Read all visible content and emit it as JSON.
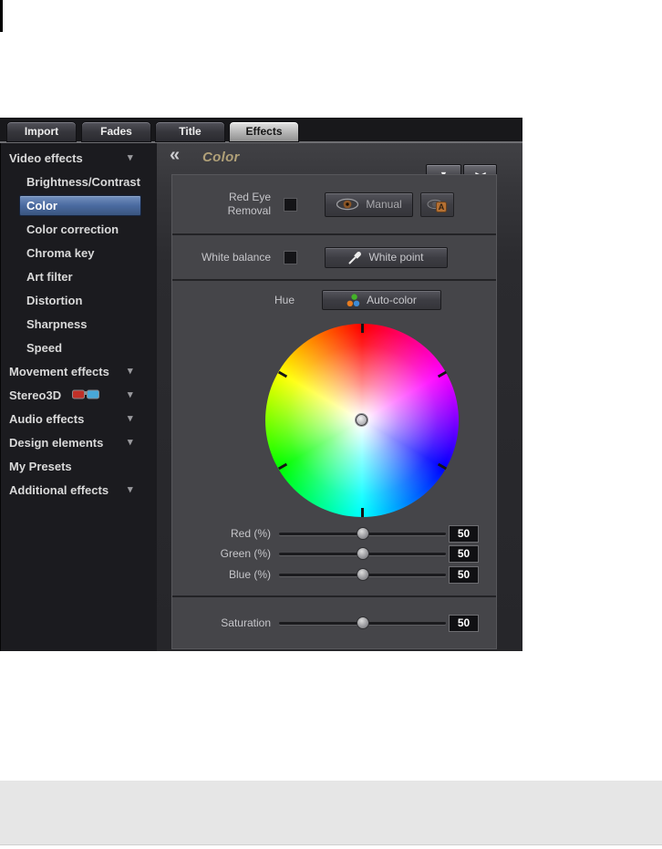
{
  "tabs": [
    {
      "label": "Import",
      "selected": false
    },
    {
      "label": "Fades",
      "selected": false
    },
    {
      "label": "Title",
      "selected": false
    },
    {
      "label": "Effects",
      "selected": true
    }
  ],
  "sidebar": {
    "items": [
      {
        "label": "Video effects",
        "level": "header",
        "has_arrow": true,
        "selected": false
      },
      {
        "label": "Brightness/Contrast",
        "level": "child",
        "has_arrow": false,
        "selected": false
      },
      {
        "label": "Color",
        "level": "child",
        "has_arrow": false,
        "selected": true
      },
      {
        "label": "Color correction",
        "level": "child",
        "has_arrow": false,
        "selected": false
      },
      {
        "label": "Chroma key",
        "level": "child",
        "has_arrow": false,
        "selected": false
      },
      {
        "label": "Art filter",
        "level": "child",
        "has_arrow": false,
        "selected": false
      },
      {
        "label": "Distortion",
        "level": "child",
        "has_arrow": false,
        "selected": false
      },
      {
        "label": "Sharpness",
        "level": "child",
        "has_arrow": false,
        "selected": false
      },
      {
        "label": "Speed",
        "level": "child",
        "has_arrow": false,
        "selected": false
      },
      {
        "label": "Movement effects",
        "level": "header",
        "has_arrow": true,
        "selected": false
      },
      {
        "label": "Stereo3D",
        "level": "header",
        "has_arrow": true,
        "icon": "3d-glasses",
        "selected": false
      },
      {
        "label": "Audio effects",
        "level": "header",
        "has_arrow": true,
        "selected": false
      },
      {
        "label": "Design elements",
        "level": "header",
        "has_arrow": true,
        "selected": false
      },
      {
        "label": "My Presets",
        "level": "header",
        "has_arrow": false,
        "selected": false
      },
      {
        "label": "Additional effects",
        "level": "header",
        "has_arrow": true,
        "selected": false
      }
    ]
  },
  "panel": {
    "title": "Color",
    "red_eye": {
      "label_line1": "Red Eye",
      "label_line2": "Removal",
      "checkbox_checked": false,
      "manual_button": "Manual"
    },
    "white_balance": {
      "label": "White balance",
      "checkbox_checked": false,
      "button": "White point"
    },
    "hue": {
      "label": "Hue",
      "auto_color_button": "Auto-color"
    },
    "color_wheel": {
      "type": "hue-wheel",
      "hues_clockwise_from_top": [
        "red",
        "magenta",
        "blue",
        "cyan",
        "green",
        "yellow"
      ],
      "tick_count": 6,
      "selection_position": "center"
    },
    "rgb_sliders": [
      {
        "label": "Red (%)",
        "value": "50",
        "percent": 50
      },
      {
        "label": "Green (%)",
        "value": "50",
        "percent": 50
      },
      {
        "label": "Blue (%)",
        "value": "50",
        "percent": 50
      }
    ],
    "saturation": {
      "label": "Saturation",
      "value": "50",
      "percent": 50
    }
  },
  "icons": {
    "collapse": "«",
    "dropdown": "▼",
    "compare": "▶◀",
    "sidebar_arrow": "▾"
  },
  "colors": {
    "selected_item_blue": "#4a6aa0",
    "title_gold": "#b0a078",
    "panel_background": "#3d3d41",
    "sidebar_background": "#1b1b1f",
    "section_background": "#454549",
    "selected_tab_silver": "#b4b4b4",
    "stereo3d_red_lens": "#c03028",
    "stereo3d_blue_lens": "#48a8d8",
    "auto_color_dot_green": "#44b428",
    "auto_color_dot_orange": "#e87c20",
    "auto_color_dot_blue": "#3c8cd8",
    "red_eye_iris_brown": "#8a5526"
  }
}
